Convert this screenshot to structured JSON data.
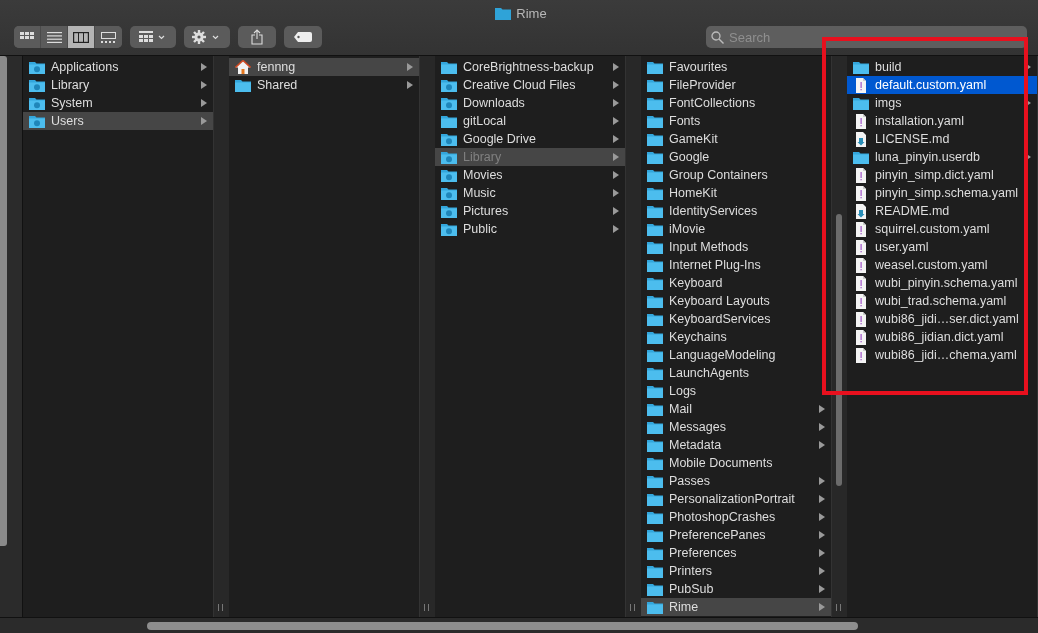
{
  "window": {
    "title": "Rime"
  },
  "view_modes": [
    {
      "kind": "icons",
      "selected": false
    },
    {
      "kind": "list",
      "selected": false
    },
    {
      "kind": "columns",
      "selected": true
    },
    {
      "kind": "gallery",
      "selected": false
    }
  ],
  "search": {
    "placeholder": "Search"
  },
  "highlight_frame": true,
  "columns": [
    {
      "focused": false,
      "items": [
        {
          "name": "Applications",
          "kind": "special-folder",
          "has_children": true,
          "selected": false
        },
        {
          "name": "Library",
          "kind": "special-folder",
          "has_children": true,
          "selected": false
        },
        {
          "name": "System",
          "kind": "special-folder",
          "has_children": true,
          "selected": false
        },
        {
          "name": "Users",
          "kind": "special-folder",
          "has_children": true,
          "selected": true
        }
      ]
    },
    {
      "focused": false,
      "items": [
        {
          "name": "fennng",
          "kind": "home",
          "has_children": true,
          "selected": true
        },
        {
          "name": "Shared",
          "kind": "folder",
          "has_children": true,
          "selected": false
        }
      ]
    },
    {
      "focused": false,
      "items": [
        {
          "name": "CoreBrightness-backup",
          "kind": "folder",
          "has_children": true,
          "selected": false,
          "dimmed": false
        },
        {
          "name": "Creative Cloud Files",
          "kind": "special-folder",
          "has_children": true,
          "selected": false,
          "dimmed": false
        },
        {
          "name": "Downloads",
          "kind": "special-folder",
          "has_children": true,
          "selected": false,
          "dimmed": false
        },
        {
          "name": "gitLocal",
          "kind": "folder",
          "has_children": true,
          "selected": false,
          "dimmed": false
        },
        {
          "name": "Google Drive",
          "kind": "special-folder",
          "has_children": true,
          "selected": false,
          "dimmed": false
        },
        {
          "name": "Library",
          "kind": "special-folder",
          "has_children": true,
          "selected": true,
          "dimmed": true
        },
        {
          "name": "Movies",
          "kind": "special-folder",
          "has_children": true,
          "selected": false,
          "dimmed": false
        },
        {
          "name": "Music",
          "kind": "special-folder",
          "has_children": true,
          "selected": false,
          "dimmed": false
        },
        {
          "name": "Pictures",
          "kind": "special-folder",
          "has_children": true,
          "selected": false,
          "dimmed": false
        },
        {
          "name": "Public",
          "kind": "special-folder",
          "has_children": true,
          "selected": false,
          "dimmed": false
        }
      ]
    },
    {
      "focused": false,
      "items": [
        {
          "name": "Favourites",
          "kind": "folder",
          "has_children": false,
          "selected": false
        },
        {
          "name": "FileProvider",
          "kind": "folder",
          "has_children": false,
          "selected": false
        },
        {
          "name": "FontCollections",
          "kind": "folder",
          "has_children": false,
          "selected": false
        },
        {
          "name": "Fonts",
          "kind": "folder",
          "has_children": false,
          "selected": false
        },
        {
          "name": "GameKit",
          "kind": "folder",
          "has_children": false,
          "selected": false
        },
        {
          "name": "Google",
          "kind": "folder",
          "has_children": false,
          "selected": false
        },
        {
          "name": "Group Containers",
          "kind": "folder",
          "has_children": false,
          "selected": false
        },
        {
          "name": "HomeKit",
          "kind": "folder",
          "has_children": false,
          "selected": false
        },
        {
          "name": "IdentityServices",
          "kind": "folder",
          "has_children": false,
          "selected": false
        },
        {
          "name": "iMovie",
          "kind": "folder",
          "has_children": false,
          "selected": false
        },
        {
          "name": "Input Methods",
          "kind": "folder",
          "has_children": false,
          "selected": false
        },
        {
          "name": "Internet Plug-Ins",
          "kind": "folder",
          "has_children": false,
          "selected": false
        },
        {
          "name": "Keyboard",
          "kind": "folder",
          "has_children": false,
          "selected": false
        },
        {
          "name": "Keyboard Layouts",
          "kind": "folder",
          "has_children": false,
          "selected": false
        },
        {
          "name": "KeyboardServices",
          "kind": "folder",
          "has_children": false,
          "selected": false
        },
        {
          "name": "Keychains",
          "kind": "folder",
          "has_children": false,
          "selected": false
        },
        {
          "name": "LanguageModeling",
          "kind": "folder",
          "has_children": false,
          "selected": false
        },
        {
          "name": "LaunchAgents",
          "kind": "folder",
          "has_children": false,
          "selected": false
        },
        {
          "name": "Logs",
          "kind": "folder",
          "has_children": false,
          "selected": false
        },
        {
          "name": "Mail",
          "kind": "folder",
          "has_children": true,
          "selected": false
        },
        {
          "name": "Messages",
          "kind": "folder",
          "has_children": true,
          "selected": false
        },
        {
          "name": "Metadata",
          "kind": "folder",
          "has_children": true,
          "selected": false
        },
        {
          "name": "Mobile Documents",
          "kind": "folder",
          "has_children": false,
          "selected": false
        },
        {
          "name": "Passes",
          "kind": "folder",
          "has_children": true,
          "selected": false
        },
        {
          "name": "PersonalizationPortrait",
          "kind": "folder",
          "has_children": true,
          "selected": false
        },
        {
          "name": "PhotoshopCrashes",
          "kind": "folder",
          "has_children": true,
          "selected": false
        },
        {
          "name": "PreferencePanes",
          "kind": "folder",
          "has_children": true,
          "selected": false
        },
        {
          "name": "Preferences",
          "kind": "folder",
          "has_children": true,
          "selected": false
        },
        {
          "name": "Printers",
          "kind": "folder",
          "has_children": true,
          "selected": false
        },
        {
          "name": "PubSub",
          "kind": "folder",
          "has_children": true,
          "selected": false
        },
        {
          "name": "Rime",
          "kind": "folder",
          "has_children": true,
          "selected": true
        }
      ]
    },
    {
      "focused": true,
      "items": [
        {
          "name": "build",
          "kind": "folder",
          "has_children": true,
          "selected": false
        },
        {
          "name": "default.custom.yaml",
          "kind": "text-file",
          "has_children": false,
          "selected": true
        },
        {
          "name": "imgs",
          "kind": "folder",
          "has_children": true,
          "selected": false
        },
        {
          "name": "installation.yaml",
          "kind": "text-file",
          "has_children": false,
          "selected": false
        },
        {
          "name": "LICENSE.md",
          "kind": "doc-file",
          "has_children": false,
          "selected": false
        },
        {
          "name": "luna_pinyin.userdb",
          "kind": "folder",
          "has_children": true,
          "selected": false
        },
        {
          "name": "pinyin_simp.dict.yaml",
          "kind": "text-file",
          "has_children": false,
          "selected": false
        },
        {
          "name": "pinyin_simp.schema.yaml",
          "kind": "text-file",
          "has_children": false,
          "selected": false
        },
        {
          "name": "README.md",
          "kind": "doc-file",
          "has_children": false,
          "selected": false
        },
        {
          "name": "squirrel.custom.yaml",
          "kind": "text-file",
          "has_children": false,
          "selected": false
        },
        {
          "name": "user.yaml",
          "kind": "text-file",
          "has_children": false,
          "selected": false
        },
        {
          "name": "weasel.custom.yaml",
          "kind": "text-file",
          "has_children": false,
          "selected": false
        },
        {
          "name": "wubi_pinyin.schema.yaml",
          "kind": "text-file",
          "has_children": false,
          "selected": false
        },
        {
          "name": "wubi_trad.schema.yaml",
          "kind": "text-file",
          "has_children": false,
          "selected": false
        },
        {
          "name": "wubi86_jidi…ser.dict.yaml",
          "kind": "text-file",
          "has_children": false,
          "selected": false
        },
        {
          "name": "wubi86_jidian.dict.yaml",
          "kind": "text-file",
          "has_children": false,
          "selected": false
        },
        {
          "name": "wubi86_jidi…chema.yaml",
          "kind": "text-file",
          "has_children": false,
          "selected": false
        }
      ]
    }
  ]
}
